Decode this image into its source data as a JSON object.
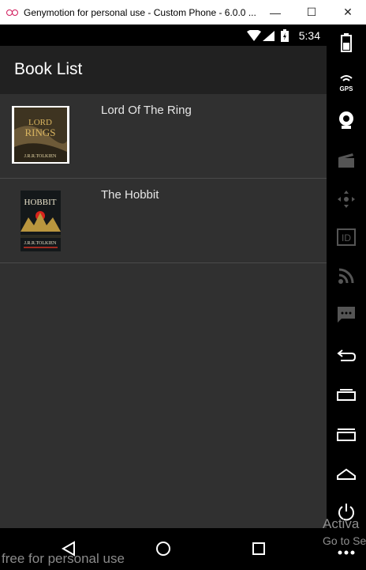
{
  "window": {
    "title": "Genymotion for personal use - Custom Phone - 6.0.0 ...",
    "minimize_label": "—",
    "maximize_label": "☐",
    "close_label": "✕"
  },
  "status_bar": {
    "time": "5:34"
  },
  "app": {
    "title": "Book List",
    "books": [
      {
        "title": "Lord Of The Ring",
        "cover_icon": "lotr-cover-image"
      },
      {
        "title": "The Hobbit",
        "cover_icon": "hobbit-cover-image"
      }
    ]
  },
  "nav": {
    "back_icon": "back-triangle-icon",
    "home_icon": "home-circle-icon",
    "recents_icon": "recents-square-icon"
  },
  "watermark": "free for personal use",
  "activation": {
    "line1": "Activa",
    "line2": "Go to Se"
  },
  "sidebar": {
    "gps_label": "GPS",
    "id_label": "ID",
    "icons": [
      "battery-icon",
      "gps-icon",
      "webcam-icon",
      "capture-icon",
      "dpad-icon",
      "id-icon",
      "rss-icon",
      "sms-icon",
      "back-icon",
      "recent-apps-icon",
      "menu-icon",
      "home-icon",
      "power-icon",
      "more-icon"
    ]
  },
  "colors": {
    "screen_bg": "#303030",
    "appbar_bg": "#212121",
    "statusbar_bg": "#000000",
    "divider": "#4a4a4a"
  }
}
